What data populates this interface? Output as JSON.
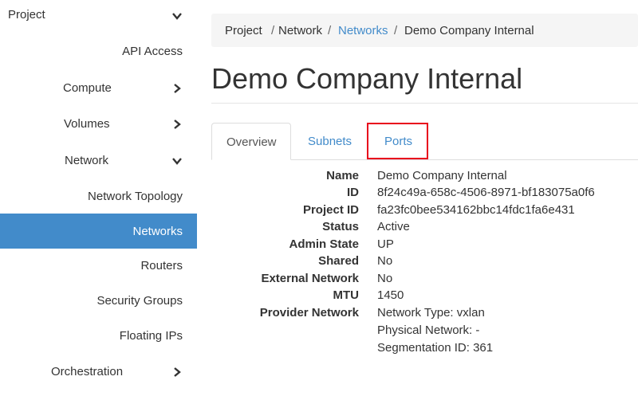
{
  "sidebar": {
    "items": [
      {
        "label": "Project"
      },
      {
        "label": "API Access"
      },
      {
        "label": "Compute"
      },
      {
        "label": "Volumes"
      },
      {
        "label": "Network"
      },
      {
        "label": "Network Topology"
      },
      {
        "label": "Networks"
      },
      {
        "label": "Routers"
      },
      {
        "label": "Security Groups"
      },
      {
        "label": "Floating IPs"
      },
      {
        "label": "Orchestration"
      }
    ]
  },
  "breadcrumb": [
    "Project",
    "Network",
    "Networks",
    "Demo Company Internal"
  ],
  "page": {
    "title": "Demo Company Internal"
  },
  "tabs": [
    {
      "label": "Overview"
    },
    {
      "label": "Subnets"
    },
    {
      "label": "Ports"
    }
  ],
  "details": {
    "name": {
      "label": "Name",
      "value": "Demo Company Internal"
    },
    "id": {
      "label": "ID",
      "value": "8f24c49a-658c-4506-8971-bf183075a0f6"
    },
    "project_id": {
      "label": "Project ID",
      "value": "fa23fc0bee534162bbc14fdc1fa6e431"
    },
    "status": {
      "label": "Status",
      "value": "Active"
    },
    "admin_state": {
      "label": "Admin State",
      "value": "UP"
    },
    "shared": {
      "label": "Shared",
      "value": "No"
    },
    "external_network": {
      "label": "External Network",
      "value": "No"
    },
    "mtu": {
      "label": "MTU",
      "value": "1450"
    },
    "provider_network": {
      "label": "Provider Network",
      "network_type": "Network Type: vxlan",
      "physical_network": "Physical Network: -",
      "segmentation_id": "Segmentation ID: 361"
    }
  },
  "colors": {
    "accent": "#428bca",
    "highlight_border": "#e8001c"
  },
  "icons": {
    "expanded": "chevron-down-icon",
    "collapsed": "chevron-right-icon"
  }
}
